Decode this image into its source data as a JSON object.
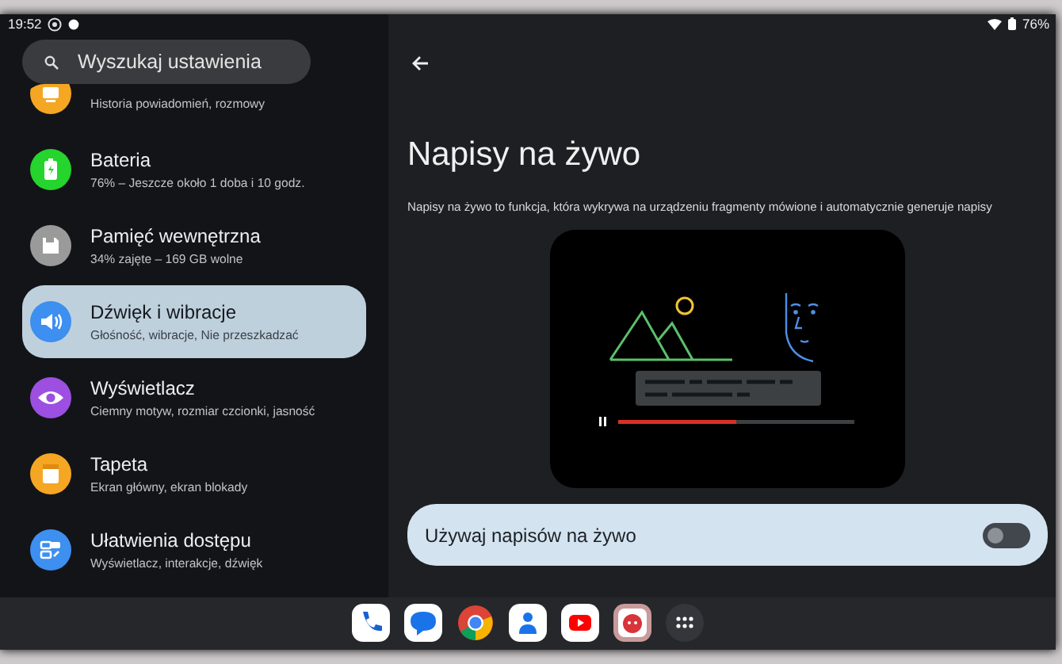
{
  "status_bar": {
    "time": "19:52",
    "battery": "76%"
  },
  "search": {
    "placeholder": "Wyszukaj ustawienia"
  },
  "settings": [
    {
      "kind": "notifications",
      "subtitle": "Historia powiadomień, rozmowy",
      "selected": false
    },
    {
      "kind": "battery",
      "title": "Bateria",
      "subtitle": "76% – Jeszcze około 1 doba i 10 godz.",
      "selected": false
    },
    {
      "kind": "storage",
      "title": "Pamięć wewnętrzna",
      "subtitle": "34% zajęte – 169 GB wolne",
      "selected": false
    },
    {
      "kind": "sound",
      "title": "Dźwięk i wibracje",
      "subtitle": "Głośność, wibracje, Nie przeszkadzać",
      "selected": true
    },
    {
      "kind": "display",
      "title": "Wyświetlacz",
      "subtitle": "Ciemny motyw, rozmiar czcionki, jasność",
      "selected": false
    },
    {
      "kind": "wallpaper",
      "title": "Tapeta",
      "subtitle": "Ekran główny, ekran blokady",
      "selected": false
    },
    {
      "kind": "accessibility",
      "title": "Ułatwienia dostępu",
      "subtitle": "Wyświetlacz, interakcje, dźwięk",
      "selected": false
    }
  ],
  "detail": {
    "title": "Napisy na żywo",
    "description": "Napisy na żywo to funkcja, która wykrywa na urządzeniu fragmenty mówione i automatycznie generuje napisy",
    "illustration": {
      "progress": {
        "level": 0.5
      }
    },
    "toggle": {
      "label": "Używaj napisów na żywo",
      "on": false
    }
  },
  "dock": [
    {
      "kind": "phone"
    },
    {
      "kind": "messages"
    },
    {
      "kind": "browser"
    },
    {
      "kind": "contacts"
    },
    {
      "kind": "video"
    },
    {
      "kind": "app"
    },
    {
      "kind": "apps"
    }
  ]
}
